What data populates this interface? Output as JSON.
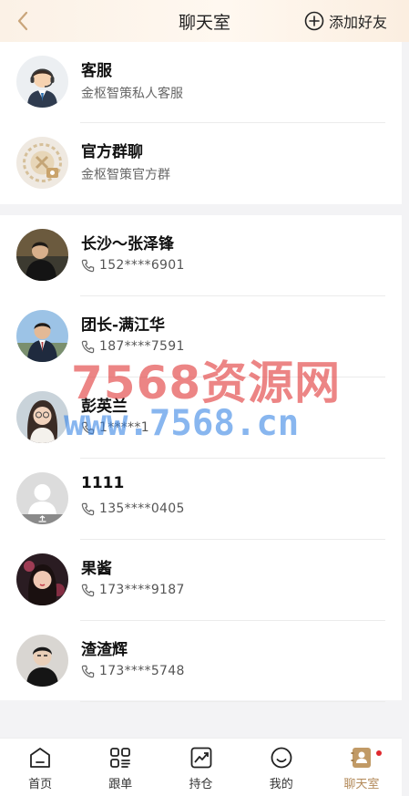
{
  "header": {
    "title": "聊天室",
    "add_friend_label": "添加好友"
  },
  "official": [
    {
      "name": "客服",
      "desc": "金枢智策私人客服"
    },
    {
      "name": "官方群聊",
      "desc": "金枢智策官方群"
    }
  ],
  "contacts": [
    {
      "name": "长沙～张泽锋",
      "phone": "152****6901"
    },
    {
      "name": "团长-满江华",
      "phone": "187****7591"
    },
    {
      "name": "彭英兰",
      "phone": "1*****1"
    },
    {
      "name": "1111",
      "phone": "135****0405"
    },
    {
      "name": "果酱",
      "phone": "173****9187"
    },
    {
      "name": "渣渣辉",
      "phone": "173****5748"
    }
  ],
  "watermark": {
    "line1": "7568资源网",
    "line2": "www.7568.cn"
  },
  "tabs": [
    {
      "label": "首页",
      "icon": "home-icon"
    },
    {
      "label": "跟单",
      "icon": "grid-icon"
    },
    {
      "label": "持仓",
      "icon": "chart-icon"
    },
    {
      "label": "我的",
      "icon": "smile-icon"
    },
    {
      "label": "聊天室",
      "icon": "contacts-icon",
      "active": true
    }
  ],
  "colors": {
    "accent": "#b38a5a",
    "badge": "#e0282e",
    "header_bg": "#fbf1e6"
  }
}
